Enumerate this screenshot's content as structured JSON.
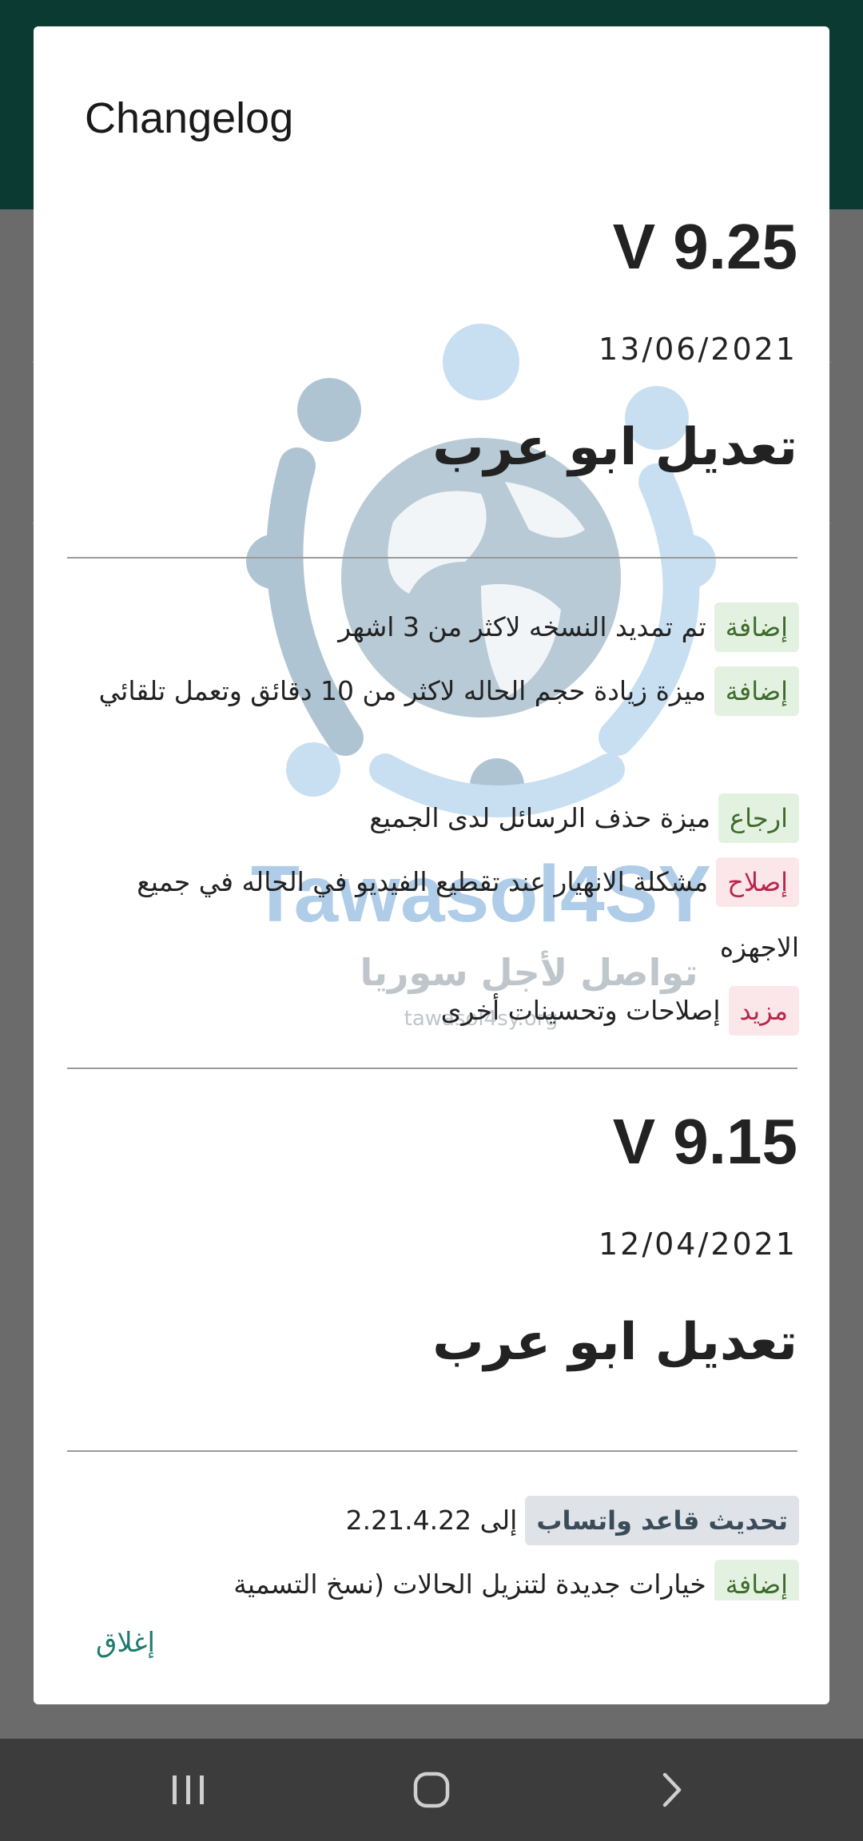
{
  "dialog": {
    "title": "Changelog",
    "close_label": "إغلاق"
  },
  "watermark": {
    "brand_text": "Tawasol4SY",
    "arabic_text": "تواصل لأجل سوريا",
    "url_text": "tawasol4sy.org"
  },
  "releases": [
    {
      "version": "V 9.25",
      "date": "13/06/2021",
      "title": "تعديل ابو عرب",
      "entries": [
        {
          "tag": "إضافة",
          "text": "تم تمديد النسخه لاكثر من 3 اشهر"
        },
        {
          "tag": "إضافة",
          "text": "ميزة زيادة حجم الحاله لاكثر من 10 دقائق وتعمل تلقائي"
        },
        {
          "tag": "ارجاع",
          "text": "ميزة حذف الرسائل لدى الجميع"
        },
        {
          "tag": "إصلاح",
          "text": "مشكلة الانهيار عند تقطيع الفيديو في الحاله في جميع الاجهزه"
        },
        {
          "tag": "مزيد",
          "text": "إصلاحات وتحسينات أخرى"
        }
      ]
    },
    {
      "version": "V 9.15",
      "date": "12/04/2021",
      "title": "تعديل ابو عرب",
      "entries": [
        {
          "tag": "تحديث قاعد واتساب",
          "text": "إلى 2.21.4.22"
        },
        {
          "tag": "إضافة",
          "text": "خيارات جديدة لتنزيل الحالات (نسخ التسمية"
        }
      ]
    }
  ],
  "colors": {
    "accent": "#1c7c6c",
    "header_bg": "#0b3a33",
    "tag_add_bg": "#e3f2e0",
    "tag_fix_bg": "#fbe6ea",
    "tag_update_bg": "#dfe3e8"
  }
}
